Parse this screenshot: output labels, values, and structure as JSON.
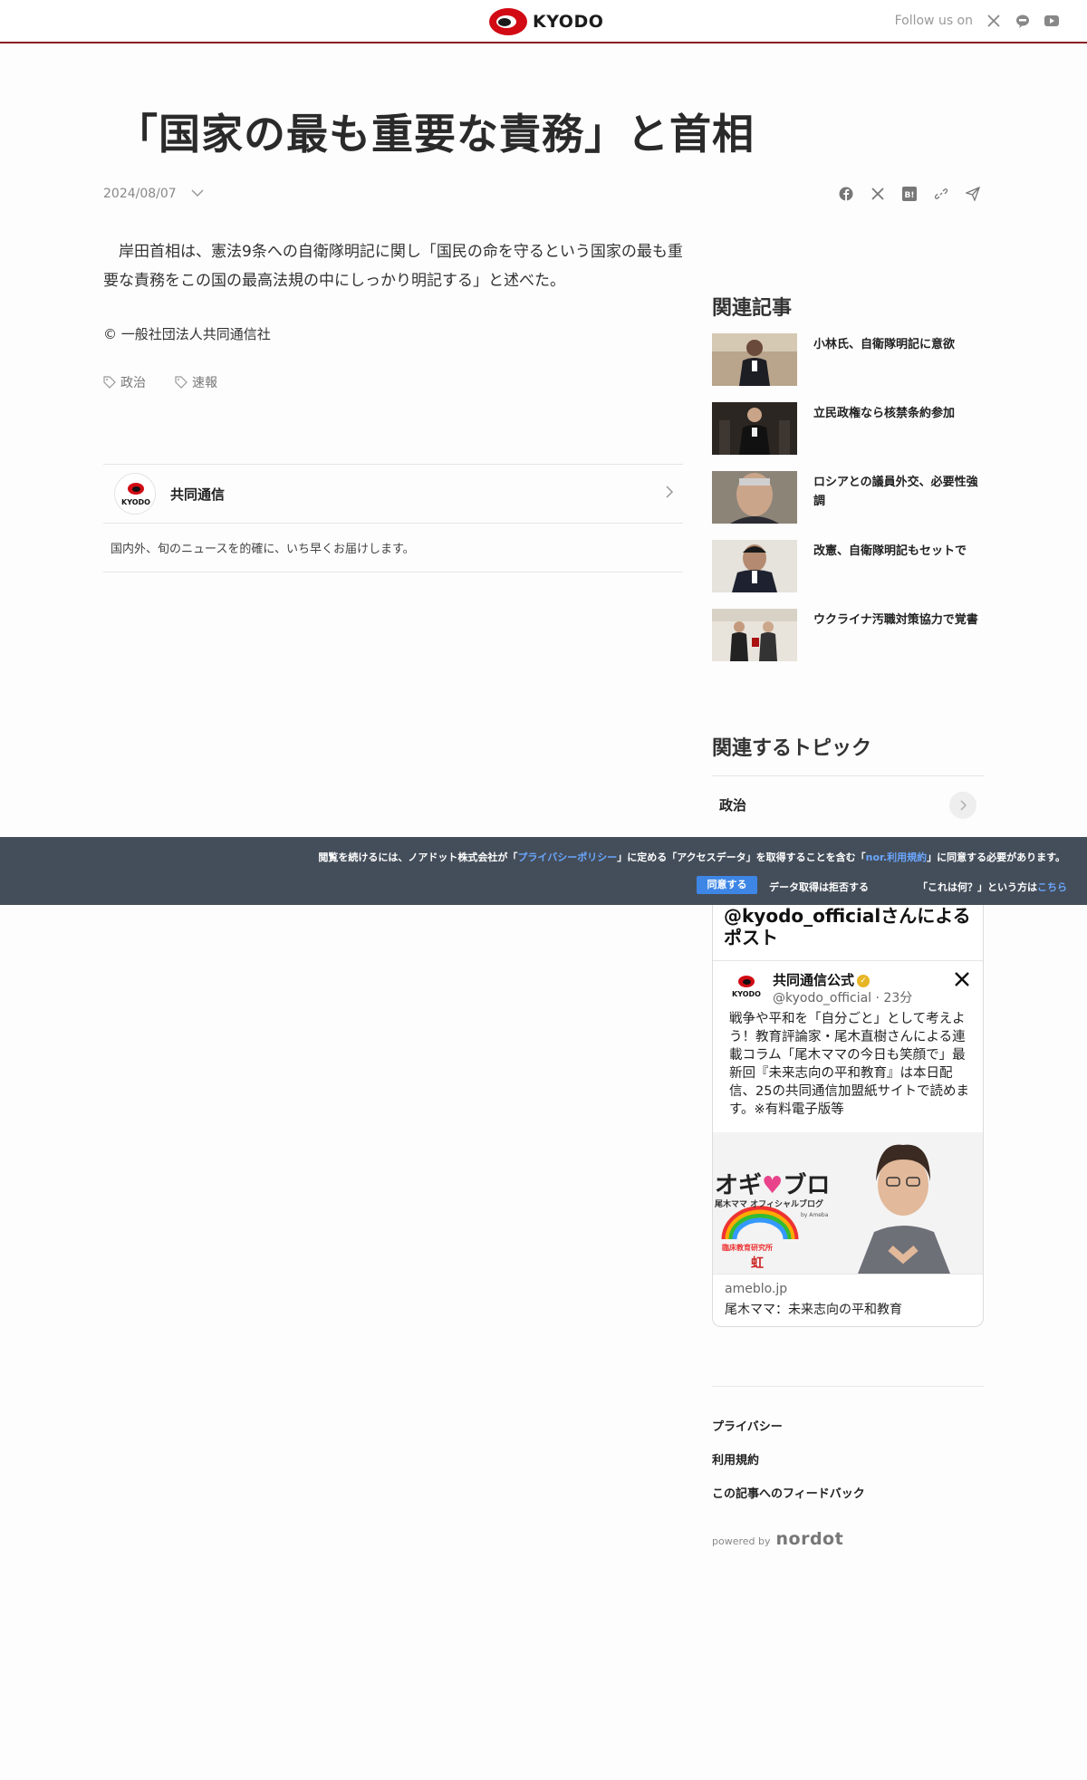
{
  "header": {
    "brand": "KYODO",
    "follow_label": "Follow us on",
    "social_icons": [
      "x-icon",
      "line-icon",
      "youtube-icon"
    ]
  },
  "article": {
    "title": "「国家の最も重要な責務」と首相",
    "date": "2024/08/07",
    "share_icons": [
      "facebook-icon",
      "x-icon",
      "hatena-icon",
      "link-icon",
      "send-icon"
    ],
    "body": "　岸田首相は、憲法9条への自衛隊明記に関し「国民の命を守るという国家の最も重要な責務をこの国の最高法規の中にしっかり明記する」と述べた。",
    "copyright": "© 一般社団法人共同通信社",
    "tags": [
      "政治",
      "速報"
    ]
  },
  "publisher": {
    "logo_text": "KYODO",
    "name": "共同通信",
    "description": "国内外、旬のニュースを的確に、いち早くお届けします。"
  },
  "related": {
    "heading": "関連記事",
    "items": [
      {
        "title": "小林氏、自衛隊明記に意欲"
      },
      {
        "title": "立民政権なら核禁条約参加"
      },
      {
        "title": "ロシアとの議員外交、必要性強調"
      },
      {
        "title": "改憲、自衛隊明記もセットで"
      },
      {
        "title": "ウクライナ汚職対策協力で覚書"
      }
    ]
  },
  "topics": {
    "heading": "関連するトピック",
    "items": [
      {
        "label": "政治"
      }
    ]
  },
  "consent": {
    "msg_pre": "閲覧を続けるには、ノアドット株式会社が「",
    "privacy_link": "プライバシーポリシー",
    "msg_mid": "」に定める「アクセスデータ」を取得することを含む「",
    "terms_link": "nor.利用規約",
    "msg_post": "」に同意する必要があります。",
    "agree_label": "同意する",
    "refuse_label": "データ取得は拒否する",
    "what_label": "「これは何？」という方は",
    "what_link": "こちら"
  },
  "embed": {
    "heading": "@kyodo_officialさんによるポスト",
    "avatar_text": "KYODO",
    "author_name": "共同通信公式",
    "author_handle": "@kyodo_official · 23分",
    "text": "戦争や平和を「自分ごと」として考えよう！教育評論家・尾木直樹さんによる連載コラム「尾木ママの今日も笑顔で」最新回『未来志向の平和教育』は本日配信、25の共同通信加盟紙サイトで読めます。※有料電子版等",
    "image_title": "オギ",
    "image_title2": "ブロ",
    "image_subtitle": "尾木ママ オフィシャルブログ",
    "image_sub2": "by Ameba",
    "image_badge": "虹",
    "image_badge_text": "臨床教育研究所",
    "link_domain": "ameblo.jp",
    "link_title": "尾木ママ：未来志向の平和教育"
  },
  "footer": {
    "links": [
      "プライバシー",
      "利用規約",
      "この記事へのフィードバック"
    ],
    "powered_by": "powered by",
    "powered_brand": "nordot"
  }
}
